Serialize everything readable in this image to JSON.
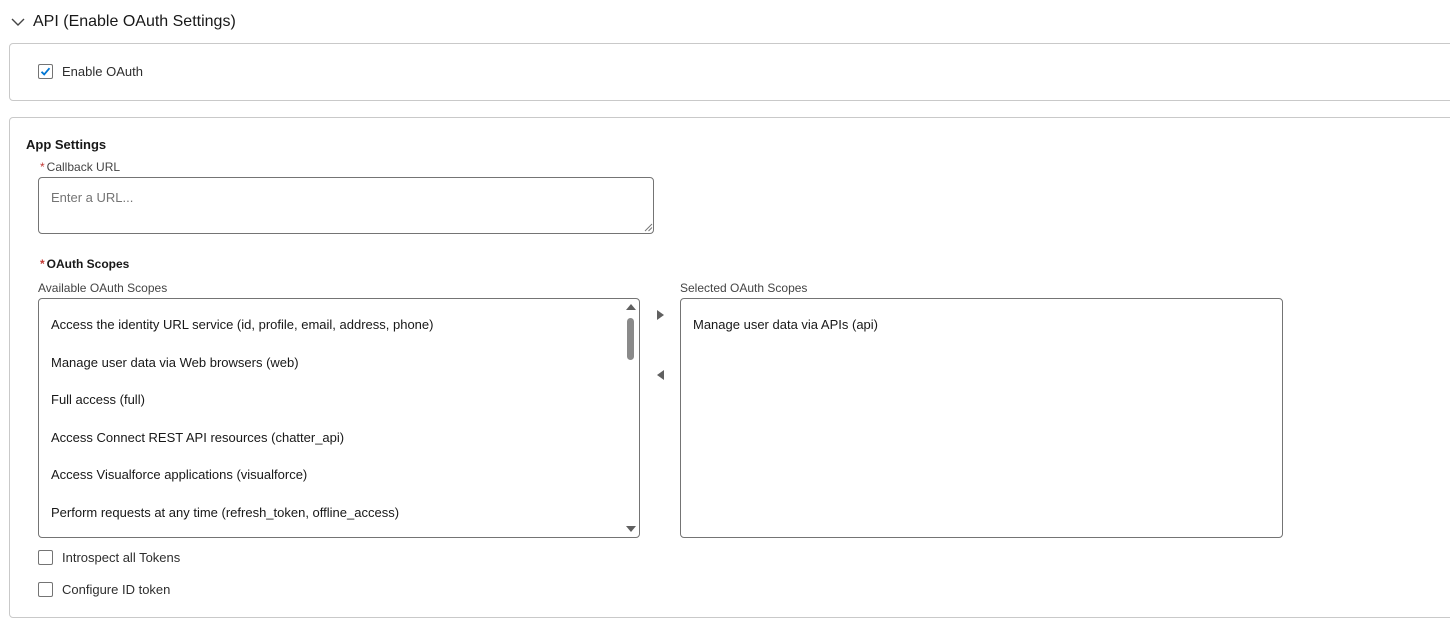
{
  "section": {
    "title": "API (Enable OAuth Settings)",
    "toggle_icon": "chevron-down-icon"
  },
  "enable_oauth": {
    "label": "Enable OAuth",
    "checked": true
  },
  "app_settings": {
    "heading": "App Settings",
    "callback_url": {
      "required_marker": "*",
      "label": "Callback URL",
      "placeholder": "Enter a URL...",
      "value": ""
    },
    "oauth_scopes": {
      "required_marker": "*",
      "label": "OAuth Scopes",
      "available_label": "Available OAuth Scopes",
      "selected_label": "Selected OAuth Scopes",
      "available": [
        "Access the identity URL service (id, profile, email, address, phone)",
        "Manage user data via Web browsers (web)",
        "Full access (full)",
        "Access Connect REST API resources (chatter_api)",
        "Access Visualforce applications (visualforce)",
        "Perform requests at any time (refresh_token, offline_access)"
      ],
      "selected": [
        "Manage user data via APIs (api)"
      ],
      "move_right_icon": "arrow-right-icon",
      "move_left_icon": "arrow-left-icon"
    },
    "introspect_tokens": {
      "label": "Introspect all Tokens",
      "checked": false
    },
    "configure_id_token": {
      "label": "Configure ID token",
      "checked": false
    }
  },
  "colors": {
    "checkbox_check": "#0176d3",
    "required": "#c23934",
    "border": "#c9c9c9"
  }
}
